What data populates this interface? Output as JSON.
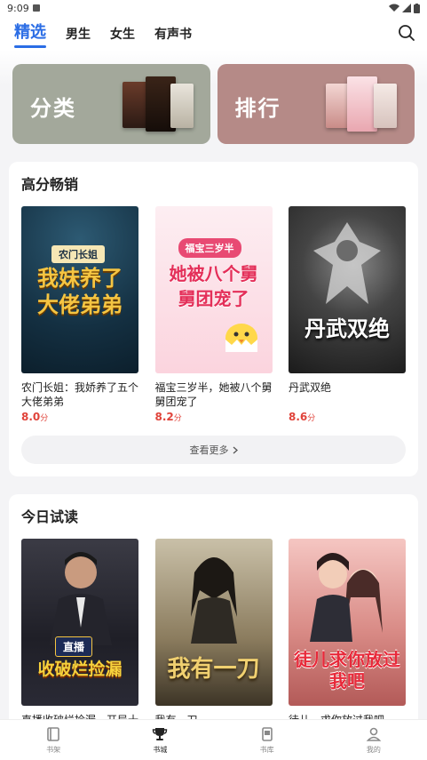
{
  "status": {
    "time": "9:09"
  },
  "topnav": {
    "tabs": [
      {
        "label": "精选",
        "active": true
      },
      {
        "label": "男生",
        "active": false
      },
      {
        "label": "女生",
        "active": false
      },
      {
        "label": "有声书",
        "active": false
      }
    ]
  },
  "banners": [
    {
      "label": "分类"
    },
    {
      "label": "排行"
    }
  ],
  "sections": {
    "top": {
      "title": "高分畅销",
      "more": "查看更多",
      "books": [
        {
          "title": "农门长姐：我娇养了五个大佬弟弟",
          "score": "8.0",
          "unit": "分",
          "cover_text": "我妹养了大佬弟弟",
          "cover_tag": "农门长姐"
        },
        {
          "title": "福宝三岁半，她被八个舅舅团宠了",
          "score": "8.2",
          "unit": "分",
          "cover_text": "她被八个舅舅团宠了",
          "cover_tag": "福宝三岁半"
        },
        {
          "title": "丹武双绝",
          "score": "8.6",
          "unit": "分",
          "cover_text": "丹武双绝",
          "cover_tag": ""
        }
      ]
    },
    "today": {
      "title": "今日试读",
      "books": [
        {
          "title": "直播收破烂捡漏，开局十万倍暴利",
          "cover_text": "收破烂捡漏",
          "cover_tag": "直播"
        },
        {
          "title": "我有一刀",
          "cover_text": "我有一刀",
          "cover_tag": ""
        },
        {
          "title": "徒儿，求你放过我吧",
          "cover_text": "徒儿求你放过我吧",
          "cover_tag": ""
        }
      ]
    }
  },
  "bottomnav": [
    {
      "label": "书架",
      "icon": "bookshelf-icon",
      "active": false
    },
    {
      "label": "书城",
      "icon": "trophy-icon",
      "active": true
    },
    {
      "label": "书库",
      "icon": "library-icon",
      "active": false
    },
    {
      "label": "我的",
      "icon": "profile-icon",
      "active": false
    }
  ],
  "colors": {
    "accent": "#2b6de5",
    "score": "#e0433a"
  }
}
